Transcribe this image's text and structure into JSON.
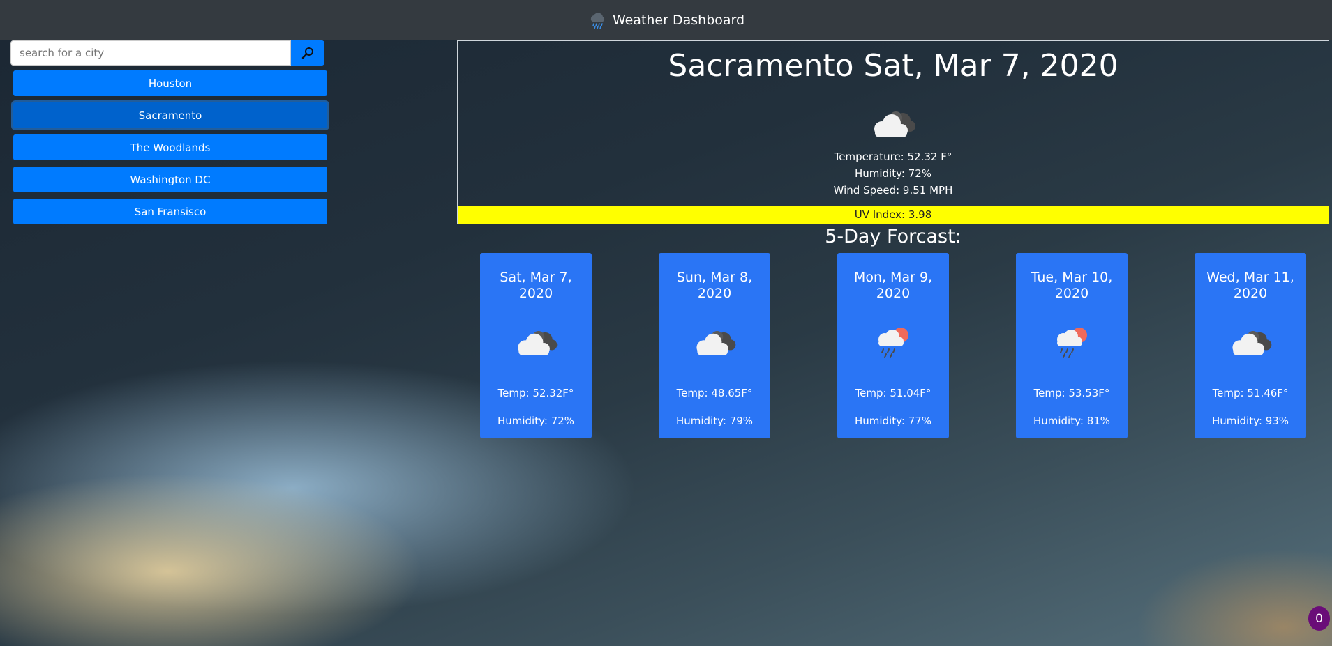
{
  "header": {
    "title": "Weather Dashboard",
    "icon": "rain-cloud-icon"
  },
  "search": {
    "placeholder": "search for a city",
    "value": "",
    "button_icon": "search-icon"
  },
  "cities": [
    {
      "label": "Houston",
      "active": false
    },
    {
      "label": "Sacramento",
      "active": true
    },
    {
      "label": "The Woodlands",
      "active": false
    },
    {
      "label": "Washington DC",
      "active": false
    },
    {
      "label": "San Fransisco",
      "active": false
    }
  ],
  "current": {
    "title": "Sacramento Sat, Mar 7, 2020",
    "icon": "cloudy-icon",
    "temperature": "Temperature: 52.32 F°",
    "humidity": "Humidity: 72%",
    "wind": "Wind Speed: 9.51 MPH",
    "uv": "UV Index: 3.98",
    "uv_color": "#ffff00"
  },
  "forecast": {
    "title": "5-Day Forcast:",
    "days": [
      {
        "date": "Sat, Mar 7, 2020",
        "icon": "cloudy-icon",
        "temp": "Temp: 52.32F°",
        "humidity": "Humidity: 72%"
      },
      {
        "date": "Sun, Mar 8, 2020",
        "icon": "cloudy-icon",
        "temp": "Temp: 48.65F°",
        "humidity": "Humidity: 79%"
      },
      {
        "date": "Mon, Mar 9, 2020",
        "icon": "sun-rain-icon",
        "temp": "Temp: 51.04F°",
        "humidity": "Humidity: 77%"
      },
      {
        "date": "Tue, Mar 10, 2020",
        "icon": "sun-rain-icon",
        "temp": "Temp: 53.53F°",
        "humidity": "Humidity: 81%"
      },
      {
        "date": "Wed, Mar 11, 2020",
        "icon": "cloudy-icon",
        "temp": "Temp: 51.46F°",
        "humidity": "Humidity: 93%"
      }
    ]
  },
  "badge": {
    "count": "0"
  },
  "colors": {
    "accent": "#007bff",
    "card": "#2a75f5",
    "navbar": "#343a40"
  }
}
